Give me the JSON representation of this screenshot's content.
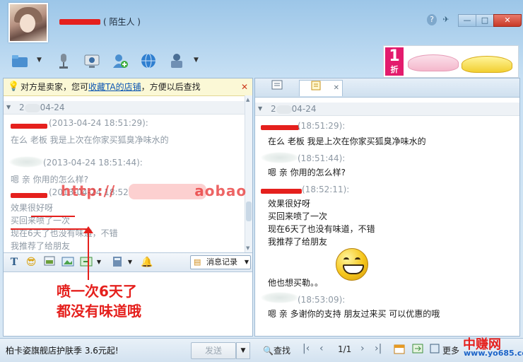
{
  "header": {
    "contact_relation": "( 陌生人 )",
    "window_controls": {
      "help": "?",
      "pin": "✈",
      "minimize": "—",
      "maximize": "□",
      "close": "✕"
    }
  },
  "toolbar": {
    "icons": [
      "folder-icon",
      "microphone-icon",
      "webcam-icon",
      "add-contact-icon",
      "globe-icon",
      "contact-card-icon"
    ]
  },
  "ad": {
    "big": "1",
    "small": "折"
  },
  "tip": {
    "before": "对方是卖家，您可",
    "link": "收藏TA的店铺",
    "after": "，方便以后查找",
    "close": "✕"
  },
  "left_history": {
    "date_prefix": "2",
    "date": "04-24",
    "messages": [
      {
        "time": "(2013-04-24 18:51:29):",
        "lines": [
          "在么  老板  我是上次在你家买狐臭净味水的"
        ]
      },
      {
        "time": "(2013-04-24 18:51:44):",
        "lines": [
          "嗯    亲    你用的怎么样?"
        ]
      },
      {
        "time": "(2013-04-24 18:52",
        "lines": [
          "效果很好呀",
          "买回来喷了一次",
          "现在6天了也没有味道，不错",
          "我推荐了给朋友"
        ]
      }
    ]
  },
  "annotation": {
    "url_start": "http://",
    "url_end": "aobao",
    "note_line1": "喷一次6天了",
    "note_line2": "都没有味道哦"
  },
  "input_toolbar": {
    "icons": [
      "font-icon",
      "emoticon-icon",
      "screenshot-icon",
      "image-icon",
      "shake-icon",
      "calculator-icon",
      "bell-icon"
    ],
    "message_record": "消息记录"
  },
  "right_history": {
    "date_prefix": "2",
    "date": "04-24",
    "messages": [
      {
        "time": "(18:51:29):",
        "lines": [
          "在么  老板  我是上次在你家买狐臭净味水的"
        ]
      },
      {
        "time": "(18:51:44):",
        "lines": [
          "嗯    亲    你用的怎么样?"
        ]
      },
      {
        "time": "(18:52:11):",
        "lines": [
          "效果很好呀",
          "买回来喷了一次",
          "现在6天了也没有味道，不错",
          "我推荐了给朋友"
        ]
      },
      {
        "time": "",
        "lines": [
          "他也想买勒。。"
        ]
      },
      {
        "time": "(18:53:09):",
        "lines": [
          "嗯  亲  多谢你的支持    朋友过来买  可以优惠的哦"
        ]
      }
    ]
  },
  "statusbar": {
    "promo": "柏卡姿旗舰店护肤季 3.6元起!",
    "send": "发送",
    "search": "查找",
    "page": "1/1",
    "more": "更多"
  },
  "watermark": {
    "cn": "中赚网",
    "url": "www.yo685.com"
  },
  "colors": {
    "redaction": "#e5201d",
    "link": "#0a54b3",
    "tip_bg": "#fbf8d6"
  }
}
